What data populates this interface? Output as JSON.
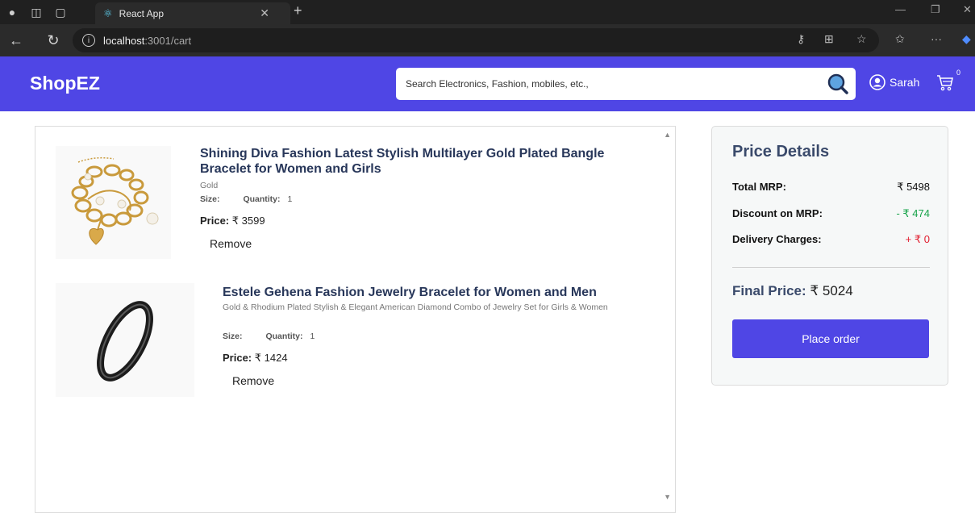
{
  "browser": {
    "tab_title": "React App",
    "url_host": "localhost",
    "url_path": ":3001/cart"
  },
  "header": {
    "brand": "ShopEZ",
    "search_placeholder": "Search Electronics, Fashion, mobiles, etc.,",
    "user_name": "Sarah",
    "cart_count": "0",
    "accent_color": "#4f46e5"
  },
  "cart": {
    "items": [
      {
        "title": "Shining Diva Fashion Latest Stylish Multilayer Gold Plated Bangle Bracelet for Women and Girls",
        "description": "Gold",
        "size_label": "Size:",
        "quantity_label": "Quantity:",
        "quantity": "1",
        "price_label": "Price:",
        "price": "₹ 3599",
        "remove_label": "Remove"
      },
      {
        "title": "Estele Gehena Fashion Jewelry Bracelet for Women and Men",
        "description": "Gold & Rhodium Plated Stylish & Elegant American Diamond Combo of Jewelry Set for Girls & Women",
        "size_label": "Size:",
        "quantity_label": "Quantity:",
        "quantity": "1",
        "price_label": "Price:",
        "price": "₹ 1424",
        "remove_label": "Remove"
      }
    ]
  },
  "price_details": {
    "title": "Price Details",
    "total_mrp_label": "Total MRP:",
    "total_mrp": "₹ 5498",
    "discount_label": "Discount on MRP:",
    "discount": "- ₹ 474",
    "delivery_label": "Delivery Charges:",
    "delivery": "+ ₹ 0",
    "final_label": "Final Price:",
    "final_price": "₹ 5024",
    "place_order_label": "Place order"
  }
}
